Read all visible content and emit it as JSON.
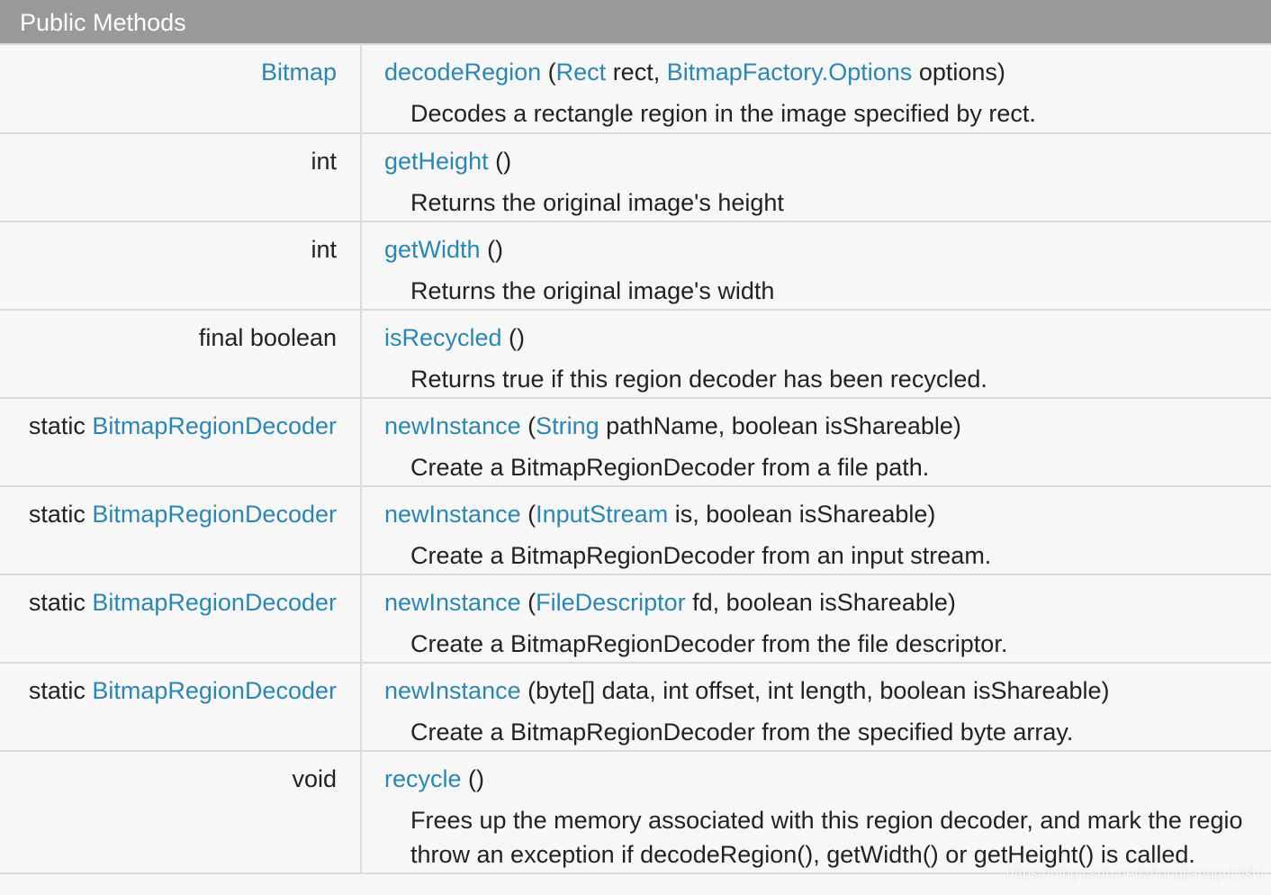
{
  "header": {
    "title": "Public Methods"
  },
  "rows": [
    {
      "type_prefix": "",
      "type_link": "Bitmap",
      "method": "decodeRegion",
      "sig_open": " (",
      "param1_link": "Rect",
      "param1_rest": " rect, ",
      "param2_link": "BitmapFactory.Options",
      "param2_rest": " options)",
      "desc": "Decodes a rectangle region in the image specified by rect."
    },
    {
      "type_text": "int",
      "method": "getHeight",
      "sig": " ()",
      "desc": "Returns the original image's height"
    },
    {
      "type_text": "int",
      "method": "getWidth",
      "sig": " ()",
      "desc": "Returns the original image's width"
    },
    {
      "type_text": "final boolean",
      "method": "isRecycled",
      "sig": " ()",
      "desc": "Returns true if this region decoder has been recycled."
    },
    {
      "type_prefix": "static ",
      "type_link": "BitmapRegionDecoder",
      "method": "newInstance",
      "sig_open": " (",
      "param1_link": "String",
      "param1_rest": " pathName, boolean isShareable)",
      "desc": "Create a BitmapRegionDecoder from a file path."
    },
    {
      "type_prefix": "static ",
      "type_link": "BitmapRegionDecoder",
      "method": "newInstance",
      "sig_open": " (",
      "param1_link": "InputStream",
      "param1_rest": " is, boolean isShareable)",
      "desc": "Create a BitmapRegionDecoder from an input stream."
    },
    {
      "type_prefix": "static ",
      "type_link": "BitmapRegionDecoder",
      "method": "newInstance",
      "sig_open": " (",
      "param1_link": "FileDescriptor",
      "param1_rest": " fd, boolean isShareable)",
      "desc": "Create a BitmapRegionDecoder from the file descriptor."
    },
    {
      "type_prefix": "static ",
      "type_link": "BitmapRegionDecoder",
      "method": "newInstance",
      "sig": " (byte[] data, int offset, int length, boolean isShareable)",
      "desc": "Create a BitmapRegionDecoder from the specified byte array."
    },
    {
      "type_text": "void",
      "method": "recycle",
      "sig": " ()",
      "desc_line1": "Frees up the memory associated with this region decoder, and mark the regio",
      "desc_line2": "throw an exception if decodeRegion(), getWidth() or getHeight() is called."
    }
  ],
  "watermark": "https://blog.csdn.net/zhongjianggulyishi",
  "colors": {
    "header_bg": "#999999",
    "link": "#2b87b1",
    "row_bg": "#f7f7f7",
    "divider": "#dcdcdc"
  }
}
